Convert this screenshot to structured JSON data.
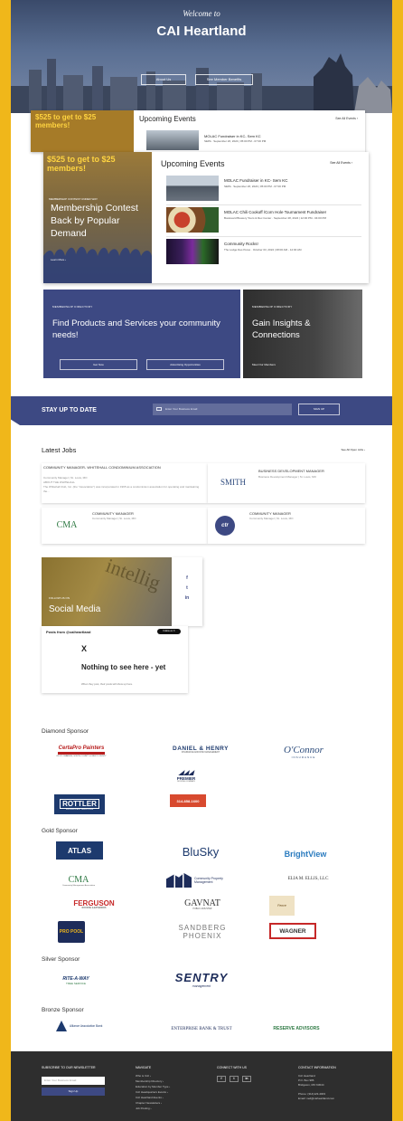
{
  "hero": {
    "welcome": "Welcome to",
    "title": "CAI Heartland",
    "about_button": "About Us",
    "benefits_button": "See Member Benefits"
  },
  "strip": {
    "promo": "$525 to get to $25 members!",
    "heading": "Upcoming Events",
    "see_all": "See All Events ›",
    "event_title": "MOLAC Fundraiser in KC- Sem KC",
    "event_detail": "SEPA · September 26, 2024 | 05:00 PM - 07:00 PM"
  },
  "events": {
    "heading": "Upcoming Events",
    "see_all": "See All Events ›",
    "promo": {
      "badge": "$525 to get to $25 members!",
      "kicker": "MEMBERSHIP CONTEST UNDER WAY",
      "headline": "Membership Contest Back by Popular Demand",
      "more": "Learn More ›"
    },
    "items": [
      {
        "title": "MOLAC Fundraiser in KC- Sem KC",
        "detail": "SEPA · September 26, 2024 | 05:00 PM - 07:00 PM"
      },
      {
        "title": "MOLAC Chili Cookoff /Corn Hole Tournament Fundraiser",
        "detail": "Boulevard Brewery Tours & Rec Center · September 28, 2024 | 12:00 PM - 04:00 PM"
      },
      {
        "title": "Community Rocks!",
        "detail": "The Lodge Des Peres · October 03, 2024 | 08:00 AM - 12:00 AM"
      }
    ]
  },
  "directory": {
    "left": {
      "kicker": "MEMBERSHIP DIRECTORY",
      "headline": "Find Products and Services your community needs!",
      "btn1": "Get Now",
      "btn2": "Advertising Opportunities"
    },
    "right": {
      "kicker": "MEMBERSHIP DIRECTORY",
      "headline": "Gain Insights & Connections",
      "link": "Meet Our Members"
    }
  },
  "newsletter": {
    "label": "STAY UP TO DATE",
    "placeholder": "Enter Your Business Email",
    "button": "SIGN UP"
  },
  "jobs": {
    "heading": "Latest Jobs",
    "see_all": "See All Open Jobs ›",
    "items": [
      {
        "title": "COMMUNITY MANAGER- WHITEHALL CONDOMINIUM ASSOCIATION",
        "sub": "Community Manager | St. Louis, MO",
        "extra": "ABOUT THE WHITEHALL",
        "desc": "The Whitehall Club, Inc. (the \"Association\") was incorporated in 1965 as a condominium association for operating and maintaining the..."
      },
      {
        "title": "BUSINESS DEVELOPMENT MANAGER",
        "sub": "Business Development Manager | St. Louis, MO",
        "logo": "SMITH"
      },
      {
        "title": "COMMUNITY MANAGER",
        "sub": "Community Manager | St. Louis, MO",
        "logo": "CMA"
      },
      {
        "title": "COMMUNITY MANAGER",
        "sub": "Community Manager | St. Louis, MO",
        "logo": "ctr"
      }
    ]
  },
  "social": {
    "kicker": "FOLLOW US ON",
    "heading": "Social Media",
    "watermark": "intellig",
    "icons": [
      "f",
      "t",
      "in"
    ],
    "feed_title": "Posts from @caiheartland",
    "follow": "Follow on X",
    "x": "X",
    "empty_head": "Nothing to see here - yet",
    "empty_desc": "When they post, their posts will show up here."
  },
  "sponsors": {
    "diamond_heading": "Diamond Sponsor",
    "gold_heading": "Gold Sponsor",
    "silver_heading": "Silver Sponsor",
    "bronze_heading": "Bronze Sponsor",
    "diamond": {
      "certapro": "CertaPro Painters",
      "certapro_sub": "OF ST. CHARLES, SOUTH COUNTY & WEST COUNTY",
      "daniel": "DANIEL & HENRY",
      "daniel_sub": "INSURANCE AND RISK MANAGEMENT",
      "oconnor": "O'Connor",
      "oconnor_sub": "INSURANCE",
      "premier": "PREMIER",
      "premier_sub": "ROOFING COMPANY",
      "premier_phone": "314-858-1600",
      "rottler": "ROTTLER",
      "rottler_sub": "PROVEN PEST SOLUTIONS"
    },
    "gold": {
      "atlas": "ATLAS",
      "blusky": "BluSky",
      "brightview": "BrightView",
      "cma": "CMA",
      "cma_sub": "Community Management Association",
      "cpm": "Community Property Management",
      "ellis": "ELIA M. ELLIS, LLC",
      "ferguson": "FERGUSON",
      "ferguson_sub": "ROOFING & EXTERIORS",
      "gavnat": "GAVNAT",
      "gavnat_sub": "PUBLIC ADJUSTER",
      "fence": "Fence",
      "pool": "PRO POOL",
      "sandberg": "SANDBERG PHOENIX",
      "wagner": "WAGNER"
    },
    "silver": {
      "rite": "RITE-A-WAY",
      "rite_sub": "TREE SERVICE",
      "sentry": "SENTRY",
      "sentry_sub": "management"
    },
    "bronze": {
      "alliance": "Alliance Association Bank",
      "enterprise": "ENTERPRISE BANK & TRUST",
      "reserve": "RESERVE ADVISORS"
    }
  },
  "footer": {
    "newsletter_heading": "SUBSCRIBE TO OUR NEWSLETTER",
    "email_placeholder": "Enter Your Business Email",
    "signup": "Sign Up",
    "navigate_heading": "NAVIGATE",
    "nav": [
      "Who is CAI ›",
      "Membership Directory ›",
      "Education by Member Type ›",
      "CAI Headquarters Events ›",
      "CAI Heartland Events ›",
      "Chapter Newsletters ›",
      "Job Posting ›"
    ],
    "connect_heading": "CONNECT WITH US",
    "social": [
      "f",
      "t",
      "in"
    ],
    "contact_heading": "CONTACT INFORMATION",
    "contact": [
      "CAI Heartland",
      "P.O. Box 986",
      "Bridgeton, MO 63044",
      "",
      "Phone: (314)123-4003",
      "Email: ned@caiheartland.com"
    ]
  }
}
